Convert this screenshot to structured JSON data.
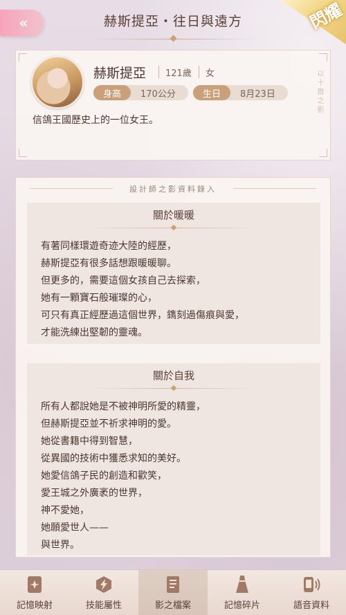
{
  "header": {
    "title": "赫斯提亞・往日與遠方",
    "back_label": "«",
    "badge_label": "閃耀"
  },
  "profile": {
    "name": "赫斯提亞",
    "age": "121歲",
    "gender": "女",
    "height_label": "身高",
    "height_value": "170公分",
    "birthday_label": "生日",
    "birthday_value": "8月23日",
    "description": "信鴿王國歷史上的一位女王。",
    "side_text": "以十齋之影"
  },
  "records": {
    "title": "設計師之影資料錄入",
    "sections": [
      {
        "title": "關於暖暖",
        "lines": [
          "有著同樣環遊奇迹大陸的經歷，",
          "赫斯提亞有很多話想跟暖暖聊。",
          "但更多的，需要這個女孩自己去探索，",
          "她有一顆寶石般璀璨的心，",
          "可只有真正經歷過這個世界，鐫刻過傷痕與愛，",
          "才能洗練出堅韌的靈魂。"
        ]
      },
      {
        "title": "關於自我",
        "lines": [
          "所有人都說她是不被神明所愛的精靈，",
          "但赫斯提亞並不祈求神明的愛。",
          "她從書籍中得到智慧，",
          "從異國的技術中獲悉求知的美好。",
          "她愛信鴿子民的創造和歡笑，",
          "愛王城之外廣袤的世界，",
          "神不愛她，",
          "她願愛世人——",
          "與世界。"
        ]
      }
    ]
  },
  "nav": {
    "items": [
      {
        "label": "記憶映射",
        "icon": "card-icon"
      },
      {
        "label": "技能屬性",
        "icon": "lightning-hexagon-icon"
      },
      {
        "label": "影之檔案",
        "icon": "document-icon"
      },
      {
        "label": "記憶碎片",
        "icon": "dress-icon"
      },
      {
        "label": "語音資料",
        "icon": "voice-phone-icon"
      }
    ],
    "active_index": 2
  },
  "colors": {
    "accent_pink": "#f6a4bb",
    "gold": "#c9a07a",
    "text_dark": "#4b3630"
  }
}
